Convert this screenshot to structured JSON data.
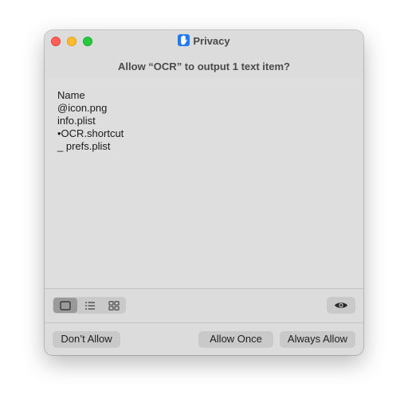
{
  "window": {
    "title": "Privacy",
    "prompt": "Allow “OCR” to output 1 text item?"
  },
  "content": {
    "lines": [
      "Name",
      "@icon.png",
      "info.plist",
      "•OCR.shortcut",
      "_ prefs.plist"
    ]
  },
  "toolbar": {
    "view_modes": [
      "single-view-icon",
      "list-view-icon",
      "grid-view-icon"
    ],
    "active_view": "single-view-icon",
    "preview_icon": "eye-icon"
  },
  "buttons": {
    "dont_allow": "Don’t Allow",
    "allow_once": "Allow Once",
    "always_allow": "Always Allow"
  },
  "colors": {
    "close": "#ff5f57",
    "minimize": "#febc2e",
    "maximize": "#28c840",
    "privacy_icon": "#1f7bf2"
  }
}
